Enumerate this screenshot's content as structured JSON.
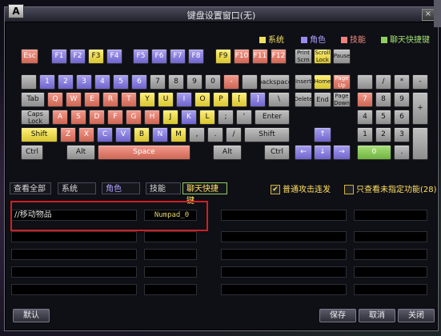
{
  "window": {
    "title": "键盘设置窗口(无)",
    "badge": "A",
    "close_label": "×"
  },
  "legend": [
    {
      "label": "系统",
      "color": "#f0e060"
    },
    {
      "label": "角色",
      "color": "#9a8af0"
    },
    {
      "label": "技能",
      "color": "#f0807a"
    },
    {
      "label": "聊天快捷键",
      "color": "#8ed060"
    }
  ],
  "keys": {
    "esc": "Esc",
    "f1": "F1",
    "f2": "F2",
    "f3": "F3",
    "f4": "F4",
    "f5": "F5",
    "f6": "F6",
    "f7": "F7",
    "f8": "F8",
    "f9": "F9",
    "f10": "F10",
    "f11": "F11",
    "f12": "F12",
    "print_scrn": "Print Scrn",
    "scroll_lock": "Scroll Lock",
    "pause": "Pause",
    "grave": "",
    "n1": "1",
    "n2": "2",
    "n3": "3",
    "n4": "4",
    "n5": "5",
    "n6": "6",
    "n7": "7",
    "n8": "8",
    "n9": "9",
    "n0": "0",
    "minus": "-",
    "equal": "",
    "backspace": "backspace",
    "insert": "Insert",
    "home": "Home",
    "page_up": "Page Up",
    "tab": "Tab",
    "q": "Q",
    "w": "W",
    "e": "E",
    "r": "R",
    "t": "T",
    "y": "Y",
    "u": "U",
    "i": "I",
    "o": "O",
    "p": "P",
    "lbracket": "[",
    "rbracket": "]",
    "backslash": "\\",
    "delete": "Delete",
    "end": "End",
    "page_down": "Page Down",
    "caps": "Caps Lock",
    "a": "A",
    "s": "S",
    "d": "D",
    "f": "F",
    "g": "G",
    "h": "H",
    "j": "J",
    "k": "K",
    "l": "L",
    "semicolon": ";",
    "quote": "'",
    "enter": "Enter",
    "shift_l": "Shift",
    "z": "Z",
    "x": "X",
    "c": "C",
    "v": "V",
    "b": "B",
    "n": "N",
    "m": "M",
    "comma": ",",
    "period": ".",
    "slash": "/",
    "shift_r": "Shift",
    "ctrl_l": "Ctrl",
    "alt_l": "Alt",
    "space": "Space",
    "alt_r": "Alt",
    "ctrl_r": "Ctrl",
    "up": "↑",
    "left": "←",
    "down": "↓",
    "right": "→",
    "np_lock": "",
    "np_div": "/",
    "np_mul": "*",
    "np_minus": "-",
    "np7": "7",
    "np8": "8",
    "np9": "9",
    "np_plus": "+",
    "np4": "4",
    "np5": "5",
    "np6": "6",
    "np1": "1",
    "np2": "2",
    "np3": "3",
    "np0": "0",
    "np_dot": ".",
    "np_enter": ""
  },
  "tabs": [
    {
      "label": "查看全部"
    },
    {
      "label": "系统"
    },
    {
      "label": "角色"
    },
    {
      "label": "技能"
    },
    {
      "label": "聊天快捷键"
    }
  ],
  "options": {
    "normal_attack": {
      "label": "普通攻击连发",
      "checked": "✔"
    },
    "unassigned": {
      "label": "只查看未指定功能(28)"
    }
  },
  "bindings": [
    {
      "name": "//移动物品",
      "key": "Numpad_0"
    },
    {
      "name": "",
      "key": ""
    },
    {
      "name": "",
      "key": ""
    },
    {
      "name": "",
      "key": ""
    },
    {
      "name": "",
      "key": ""
    },
    {
      "name": "",
      "key": ""
    },
    {
      "name": "",
      "key": ""
    },
    {
      "name": "",
      "key": ""
    }
  ],
  "buttons": {
    "default": "默认",
    "save": "保存",
    "cancel": "取消",
    "close": "关闭"
  }
}
